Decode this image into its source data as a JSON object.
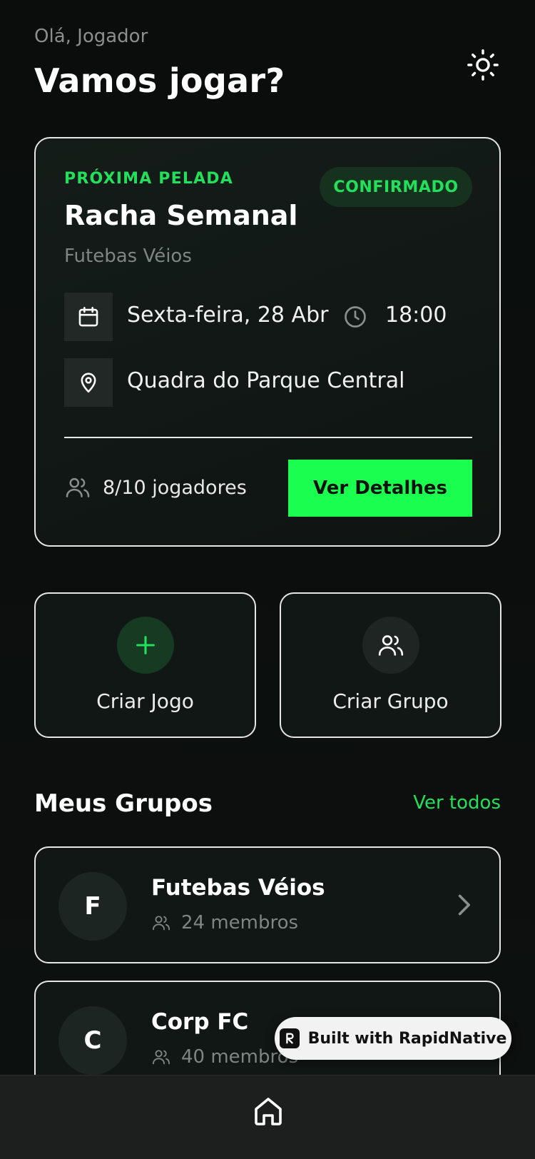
{
  "header": {
    "greeting": "Olá, Jogador",
    "headline": "Vamos jogar?",
    "theme_icon": "sun-icon"
  },
  "next_game": {
    "eyebrow": "PRÓXIMA PELADA",
    "status": "CONFIRMADO",
    "title": "Racha Semanal",
    "group": "Futebas Véios",
    "date": "Sexta-feira, 28 Abr",
    "time": "18:00",
    "location": "Quadra do Parque Central",
    "players": "8/10 jogadores",
    "details_button": "Ver Detalhes"
  },
  "actions": [
    {
      "label": "Criar Jogo",
      "icon": "plus-icon"
    },
    {
      "label": "Criar Grupo",
      "icon": "users-icon"
    }
  ],
  "groups_section": {
    "title": "Meus Grupos",
    "see_all": "Ver todos"
  },
  "groups": [
    {
      "initial": "F",
      "name": "Futebas Véios",
      "members": "24 membros"
    },
    {
      "initial": "C",
      "name": "Corp FC",
      "members": "40 membros"
    }
  ],
  "built_with": "Built with RapidNative",
  "colors": {
    "accent": "#1aff4f",
    "accent_text": "#22e05b",
    "background": "#0b0e0d",
    "card": "#111715"
  }
}
